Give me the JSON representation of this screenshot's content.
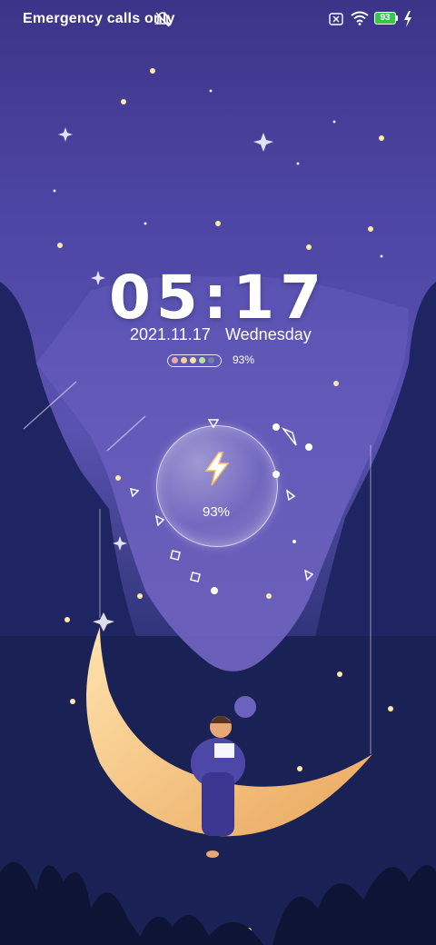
{
  "status_bar": {
    "carrier_text": "Emergency calls only",
    "battery_level": "93",
    "icons": [
      "mute-icon",
      "sim-off-icon",
      "wifi-icon",
      "battery-icon",
      "charging-bolt-icon"
    ]
  },
  "lockscreen": {
    "time": "05:17",
    "date": "2021.11.17",
    "weekday": "Wednesday",
    "battery_percent": "93%",
    "charging_percent": "93%"
  },
  "colors": {
    "sky_top": "#3c3488",
    "sky_mid": "#5a52b0",
    "night_bottom": "#141b48",
    "battery_green": "#34c94a",
    "moon": "#f3c98a"
  }
}
